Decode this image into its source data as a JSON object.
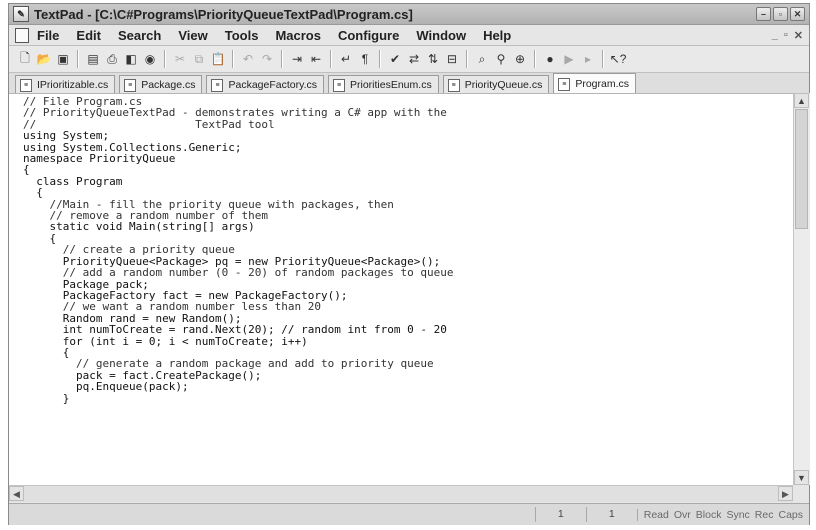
{
  "window": {
    "title": "TextPad - [C:\\C#Programs\\PriorityQueueTextPad\\Program.cs]"
  },
  "menu": [
    "File",
    "Edit",
    "Search",
    "View",
    "Tools",
    "Macros",
    "Configure",
    "Window",
    "Help"
  ],
  "toolbar": {
    "icons": [
      "new-file-icon",
      "open-folder-icon",
      "save-icon",
      "save-all-icon",
      "print-icon",
      "print-preview-icon",
      "find-icon",
      "cut-icon",
      "copy-icon",
      "paste-icon",
      "undo-icon",
      "redo-icon",
      "indent-icon",
      "outdent-icon",
      "wrap-icon",
      "paragraph-icon",
      "spell-check-icon",
      "replace-icon",
      "sort-icon",
      "compare-icon",
      "find-next-icon",
      "find-previous-icon",
      "find-in-files-icon",
      "record-macro-icon",
      "play-macro-icon",
      "help-cursor-icon"
    ]
  },
  "tabs": [
    {
      "label": "IPrioritizable.cs",
      "active": false
    },
    {
      "label": "Package.cs",
      "active": false
    },
    {
      "label": "PackageFactory.cs",
      "active": false
    },
    {
      "label": "PrioritiesEnum.cs",
      "active": false
    },
    {
      "label": "PriorityQueue.cs",
      "active": false
    },
    {
      "label": "Program.cs",
      "active": true
    }
  ],
  "code_lines": [
    "// File Program.cs",
    "// PriorityQueueTextPad - demonstrates writing a C# app with the",
    "//                        TextPad tool",
    "using System;",
    "using System.Collections.Generic;",
    "namespace PriorityQueue",
    "{",
    "  class Program",
    "  {",
    "    //Main - fill the priority queue with packages, then",
    "    // remove a random number of them",
    "    static void Main(string[] args)",
    "    {",
    "      // create a priority queue",
    "      PriorityQueue<Package> pq = new PriorityQueue<Package>();",
    "      // add a random number (0 - 20) of random packages to queue",
    "      Package pack;",
    "      PackageFactory fact = new PackageFactory();",
    "      // we want a random number less than 20",
    "      Random rand = new Random();",
    "      int numToCreate = rand.Next(20); // random int from 0 - 20",
    "      for (int i = 0; i < numToCreate; i++)",
    "      {",
    "        // generate a random package and add to priority queue",
    "        pack = fact.CreatePackage();",
    "        pq.Enqueue(pack);",
    "      }"
  ],
  "status": {
    "line": "1",
    "column": "1",
    "flags": [
      "Read",
      "Ovr",
      "Block",
      "Sync",
      "Rec",
      "Caps"
    ]
  }
}
